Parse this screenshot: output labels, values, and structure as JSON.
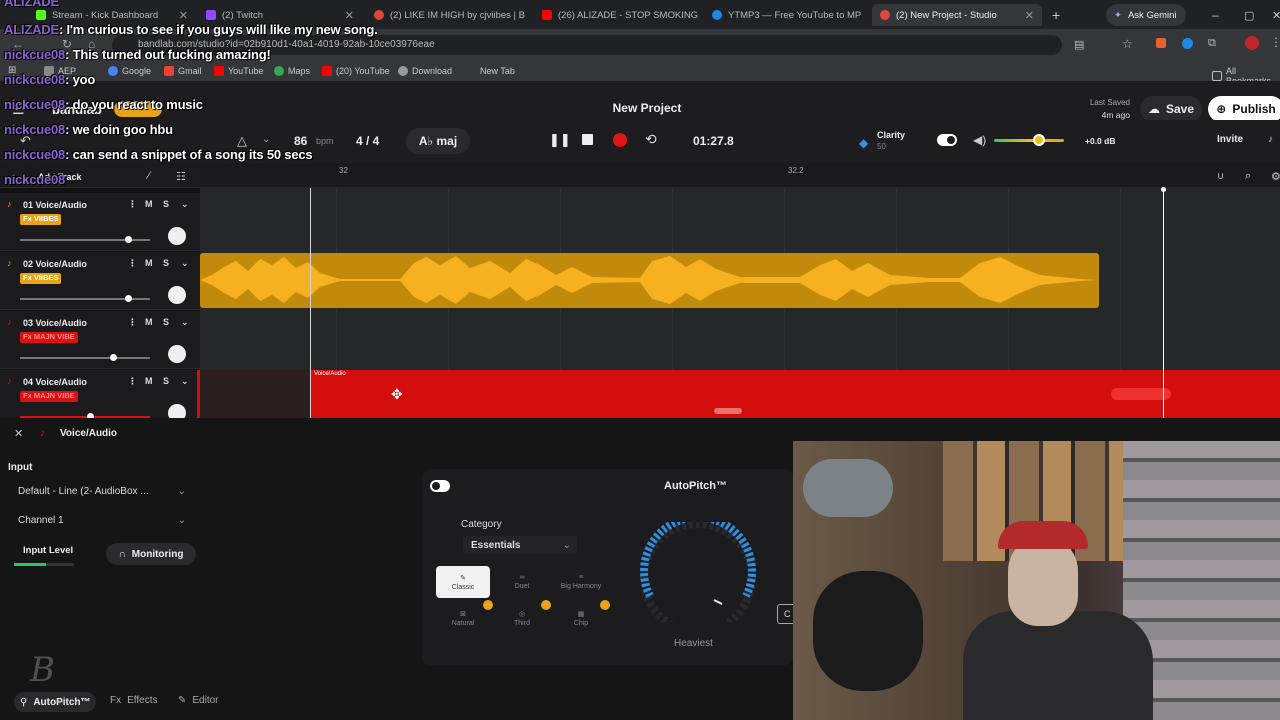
{
  "browser": {
    "tabs": [
      {
        "label": "Stream - Kick Dashboard",
        "color": "#53fc18"
      },
      {
        "label": "(2) Twitch",
        "color": "#9146ff"
      },
      {
        "label": "(2) LIKE IM HIGH by cjviibes | B",
        "color": "#e0473a"
      },
      {
        "label": "(26) ALIZADE - STOP SMOKING",
        "color": "#ff0000"
      },
      {
        "label": "YTMP3 — Free YouTube to MP",
        "color": "#1e88e5"
      },
      {
        "label": "(2) New Project - Studio",
        "color": "#e0473a"
      }
    ],
    "ask_gemini": "Ask Gemini",
    "url": "bandlab.com/studio?id=02b910d1-40a1-4019-92ab-10ce03976eae",
    "bookmarks": [
      "AEP",
      "Google",
      "Gmail",
      "YouTube",
      "Maps",
      "(20) YouTube",
      "Download",
      "New Tab"
    ],
    "all_bookmarks": "All Bookmarks"
  },
  "app": {
    "logo": "bandlab",
    "project_title": "New Project",
    "last_saved_label": "Last Saved",
    "last_saved_value": "4m ago",
    "save": "Save",
    "publish": "Publish",
    "invite": "Invite",
    "bpm_value": "86",
    "bpm_label": "bpm",
    "time_signature": "4 / 4",
    "key": "A♭ maj",
    "time": "01:27.8",
    "clarity_label": "Clarity",
    "clarity_value": "50",
    "volume_db": "+0.0 dB",
    "ruler_marks": [
      "32",
      "32.2"
    ],
    "track_header_label": "Add Track"
  },
  "tracks": [
    {
      "name": "01 Voice/Audio",
      "fx": "Fx VIIBES",
      "fx_color": "#e8a317",
      "icon_color": "#e8a317",
      "volume": 0.85
    },
    {
      "name": "02 Voice/Audio",
      "fx": "Fx VIIBES",
      "fx_color": "#e8a317",
      "icon_color": "#e8a317",
      "volume": 0.85
    },
    {
      "name": "03 Voice/Audio",
      "fx": "Fx MAJN VIBE",
      "fx_color": "#d11",
      "icon_color": "#d11",
      "volume": 0.75
    },
    {
      "name": "04 Voice/Audio",
      "fx": "Fx MAJN VIBE",
      "fx_color": "#d11",
      "icon_color": "#d11",
      "volume": 0.6
    }
  ],
  "clip_label": "Voice/Audio",
  "panel": {
    "title": "Voice/Audio",
    "input_label": "Input",
    "input_device": "Default - Line (2- AudioBox ...",
    "channel": "Channel 1",
    "input_level": "Input Level",
    "monitoring": "Monitoring",
    "autopitch_title": "AutoPitch™",
    "category_label": "Category",
    "category_value": "Essentials",
    "styles": [
      "Classic",
      "Duet",
      "Big Harmony",
      "Natural",
      "Third",
      "Chip"
    ],
    "amount_label": "Heaviest",
    "bottom_tabs": [
      "AutoPitch™",
      "Effects",
      "Editor"
    ]
  },
  "chat": [
    {
      "user": "ALIZADE",
      "msg": ""
    },
    {
      "user": "ALIZADE",
      "msg": ": I'm curious to see if you guys will like my new song."
    },
    {
      "user": "nickcue08",
      "msg": ": This turned out fucking amazing!"
    },
    {
      "user": "nickcue08",
      "msg": ": yoo"
    },
    {
      "user": "nickcue08",
      "msg": ": do you react to music"
    },
    {
      "user": "nickcue08",
      "msg": ": we doin goo hbu"
    },
    {
      "user": "nickcue08",
      "msg": ": can send a snippet of a song its 50 secs"
    },
    {
      "user": "nickcue08",
      "msg": ""
    }
  ],
  "colors": {
    "accent": "#e8a317",
    "record": "#e01515",
    "publish_bg": "#ffffff"
  }
}
